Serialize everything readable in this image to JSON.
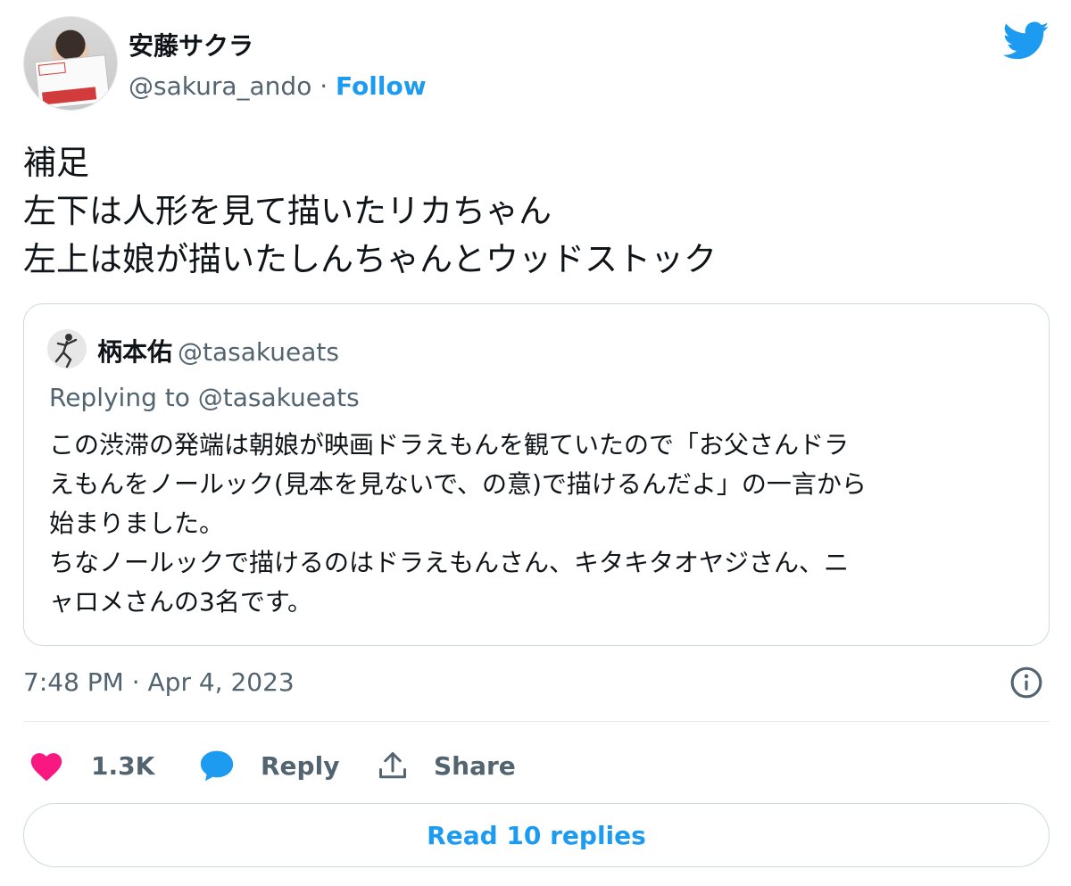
{
  "author": {
    "display_name": "安藤サクラ",
    "handle": "@sakura_ando",
    "separator": " · ",
    "follow_label": "Follow"
  },
  "tweet": {
    "lines": [
      "補足",
      "左下は人形を見て描いたリカちゃん",
      "左上は娘が描いたしんちゃんとウッドストック"
    ]
  },
  "quoted_tweet": {
    "display_name": "柄本佑",
    "handle": "@tasakueats",
    "replying_to": "Replying to @tasakueats",
    "body_lines": [
      "この渋滞の発端は朝娘が映画ドラえもんを観ていたので「お父さんドラ",
      "えもんをノールック(見本を見ないで、の意)で描けるんだよ」の一言から",
      "始まりました。",
      "ちなノールックで描けるのはドラえもんさん、キタキタオヤジさん、ニ",
      "ャロメさんの3名です。"
    ]
  },
  "meta": {
    "timestamp": "7:48 PM · Apr 4, 2023"
  },
  "actions": {
    "like_count": "1.3K",
    "reply_label": "Reply",
    "share_label": "Share"
  },
  "read_replies_label": "Read 10 replies",
  "colors": {
    "accent": "#1d9bf0",
    "like": "#f91880",
    "text": "#0f1419",
    "secondary": "#536471",
    "border": "#cfd9de"
  },
  "icons": [
    "twitter-bird-icon",
    "info-icon",
    "heart-icon",
    "reply-bubble-icon",
    "share-icon"
  ]
}
